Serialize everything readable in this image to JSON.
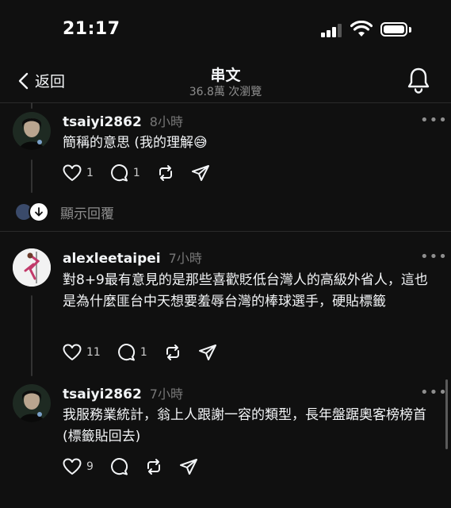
{
  "status": {
    "time": "21:17"
  },
  "nav": {
    "back_label": "返回",
    "title": "串文",
    "subtitle": "36.8萬 次瀏覽"
  },
  "posts": [
    {
      "username": "tsaiyi2862",
      "time": "8小時",
      "text": "簡稱的意思 (我的理解😅",
      "likes": "1",
      "comments": "1",
      "more": "•••"
    },
    {
      "username": "alexleetaipei",
      "time": "7小時",
      "text": "對8+9最有意見的是那些喜歡貶低台灣人的高級外省人，這也是為什麼匪台中天想要羞辱台灣的棒球選手，硬貼標籤",
      "likes": "11",
      "comments": "1",
      "more": "•••"
    },
    {
      "username": "tsaiyi2862",
      "time": "7小時",
      "text": "我服務業統計，翁上人跟謝一容的類型，長年盤踞奧客榜榜首 (標籤貼回去)",
      "likes": "9",
      "comments": "",
      "more": "•••"
    }
  ],
  "show_replies_label": "顯示回覆",
  "colors": {
    "background": "#101010",
    "text": "#f3f5f7",
    "muted": "#777777"
  }
}
